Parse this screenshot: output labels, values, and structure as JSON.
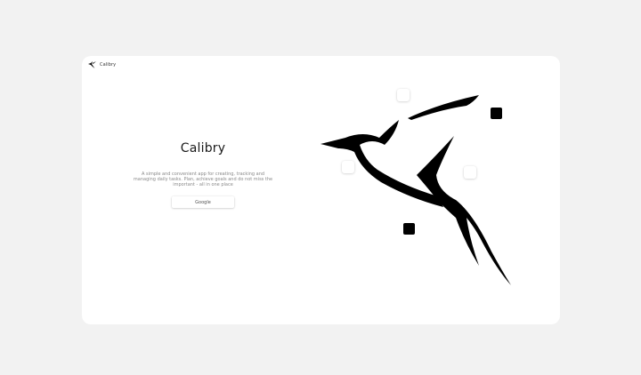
{
  "app": {
    "brand_name": "Calibry",
    "logo_icon": "swallow-icon"
  },
  "hero": {
    "title": "Calibry",
    "description": "A simple and convenient app for creating, tracking and managing daily tasks. Plan, achieve goals and do not miss the important - all in one place",
    "google_button_label": "Google"
  },
  "illustration": {
    "bird_icon": "swallow-icon",
    "tile_colors": [
      "#ffffff",
      "#000000"
    ]
  }
}
